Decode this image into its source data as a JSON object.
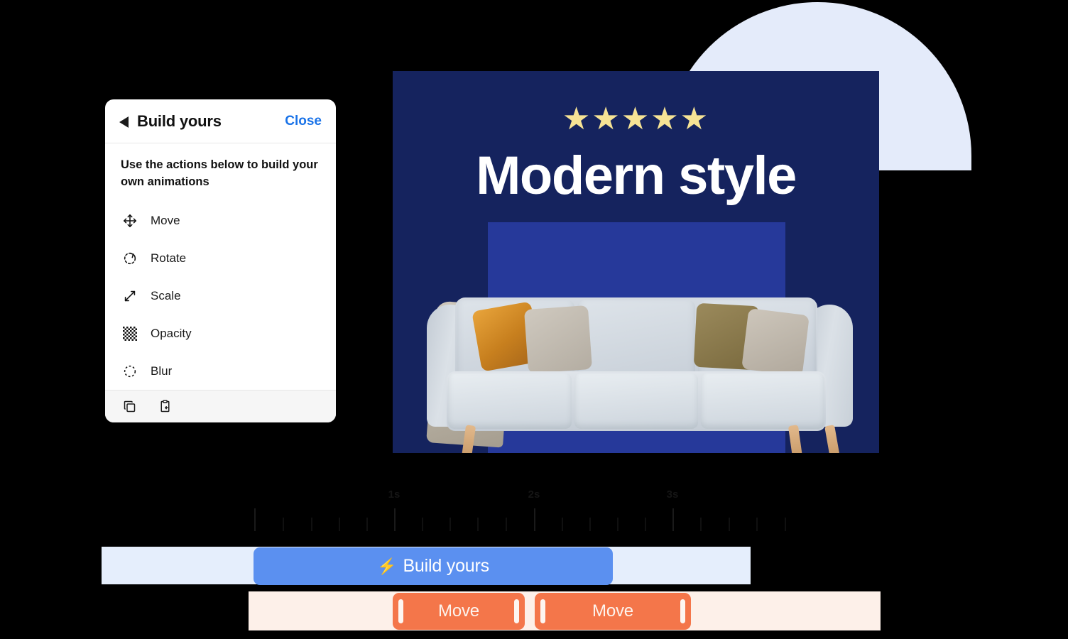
{
  "panel": {
    "title": "Build yours",
    "back_icon": "back-triangle-icon",
    "close_label": "Close",
    "description": "Use the actions below to build your own animations",
    "actions": [
      {
        "label": "Move",
        "icon": "move-arrows-icon"
      },
      {
        "label": "Rotate",
        "icon": "rotate-icon"
      },
      {
        "label": "Scale",
        "icon": "scale-diagonal-arrows-icon"
      },
      {
        "label": "Opacity",
        "icon": "checkerboard-opacity-icon"
      },
      {
        "label": "Blur",
        "icon": "dashed-circle-blur-icon"
      }
    ],
    "footer_icons": [
      {
        "name": "copy-icon"
      },
      {
        "name": "paste-icon"
      }
    ]
  },
  "banner": {
    "stars": "★★★★★",
    "star_count": 5,
    "title": "Modern style",
    "background_color": "#15235e",
    "inner_rect_color": "#26399a",
    "star_color": "#f6e395",
    "title_color": "#ffffff"
  },
  "decor": {
    "dome_color": "#e4ebfa"
  },
  "timeline": {
    "ruler_labels": [
      "1s",
      "2s",
      "3s"
    ],
    "tracks": {
      "build": {
        "clip_label": "Build yours",
        "bolt_icon": "⚡",
        "clip_color": "#5b90f0",
        "track_color": "#e5eefc"
      },
      "move": {
        "clips": [
          {
            "label": "Move"
          },
          {
            "label": "Move"
          }
        ],
        "clip_color": "#f4764a",
        "track_color": "#fdf0e9"
      }
    }
  }
}
